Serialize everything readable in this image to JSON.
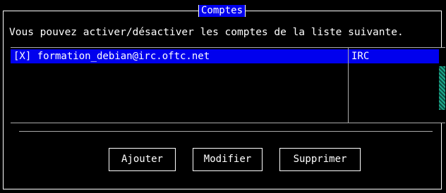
{
  "dialog": {
    "title": "Comptes",
    "intro": "Vous pouvez activer/désactiver les comptes de la liste suivante."
  },
  "accounts": [
    {
      "label": "[X] formation_debian@irc.oftc.net",
      "protocol": "IRC",
      "enabled": true,
      "selected": true
    }
  ],
  "buttons": {
    "add": "Ajouter",
    "modify": "Modifier",
    "delete": "Supprimer"
  },
  "colors": {
    "background": "#000000",
    "selection": "#0000ee",
    "scrollbar_thumb": "#1aa88a"
  }
}
